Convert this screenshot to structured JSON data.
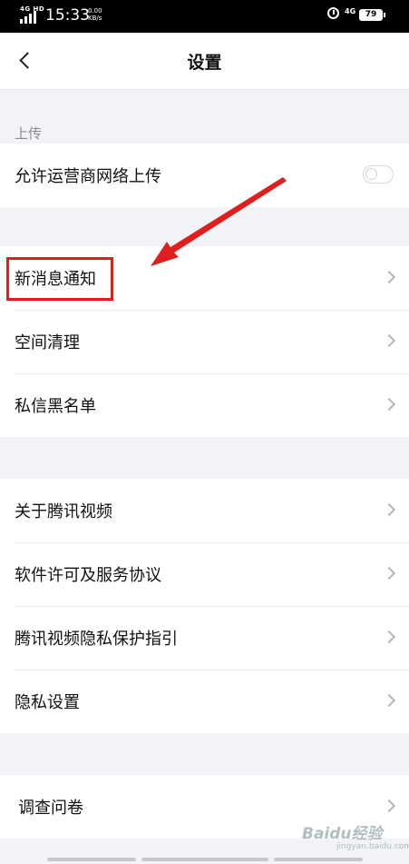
{
  "status_bar": {
    "network": "4G HD",
    "time": "15:33",
    "speed_value": "0.00",
    "speed_unit": "KB/s",
    "mobile_data": "4G",
    "battery": "79"
  },
  "header": {
    "title": "设置"
  },
  "sections": {
    "upload": {
      "label": "上传",
      "items": [
        {
          "label": "允许运营商网络上传",
          "toggle": false
        }
      ]
    },
    "group1": {
      "items": [
        {
          "label": "新消息通知"
        },
        {
          "label": "空间清理"
        },
        {
          "label": "私信黑名单"
        }
      ]
    },
    "group2": {
      "items": [
        {
          "label": "关于腾讯视频"
        },
        {
          "label": "软件许可及服务协议"
        },
        {
          "label": "腾讯视频隐私保护指引"
        },
        {
          "label": "隐私设置"
        }
      ]
    },
    "group3": {
      "items": [
        {
          "label": "调查问卷"
        }
      ]
    }
  },
  "annotation": {
    "color": "#e01e1e"
  },
  "watermark": {
    "text": "Baidu经验",
    "sub": "jingyan.baidu.com"
  }
}
